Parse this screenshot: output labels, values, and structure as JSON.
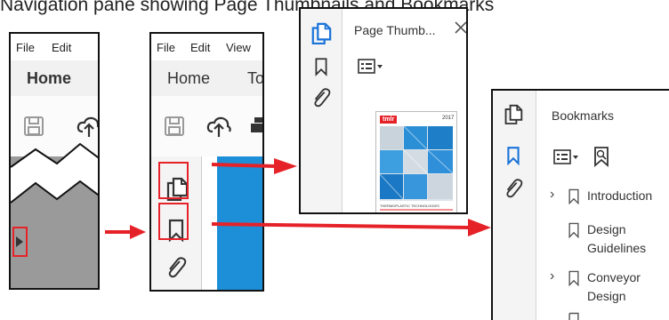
{
  "caption": "Navigation pane showing Page Thumbnails and Bookmarks",
  "panel1": {
    "menu": [
      "File",
      "Edit"
    ],
    "ribbon_tab": "Home"
  },
  "panel2": {
    "menu": [
      "File",
      "Edit",
      "View"
    ],
    "ribbon_tabs": [
      "Home",
      "To"
    ]
  },
  "panel3": {
    "title": "Page Thumb...",
    "thumbnail_brand": "tmlr",
    "thumbnail_number": "2017",
    "thumbnail_caption": "THERMOPLASTIC TECHNOLOGIES"
  },
  "panel4": {
    "title": "Bookmarks",
    "items": [
      {
        "label_lines": [
          "Introduction"
        ],
        "expandable": true
      },
      {
        "label_lines": [
          "Design",
          "Guidelines"
        ],
        "expandable": false
      },
      {
        "label_lines": [
          "Conveyor",
          "Design"
        ],
        "expandable": true
      }
    ]
  },
  "colors": {
    "accent_blue": "#1a73d9",
    "highlight_red": "#e62229",
    "document_blue": "#1d8fd8"
  },
  "icons": [
    "page-thumbnails-icon",
    "bookmark-icon",
    "attachment-icon",
    "save-icon",
    "cloud-upload-icon",
    "print-icon",
    "close-icon",
    "options-icon",
    "new-bookmark-icon",
    "chevron-right-icon",
    "expand-triangle-icon"
  ]
}
